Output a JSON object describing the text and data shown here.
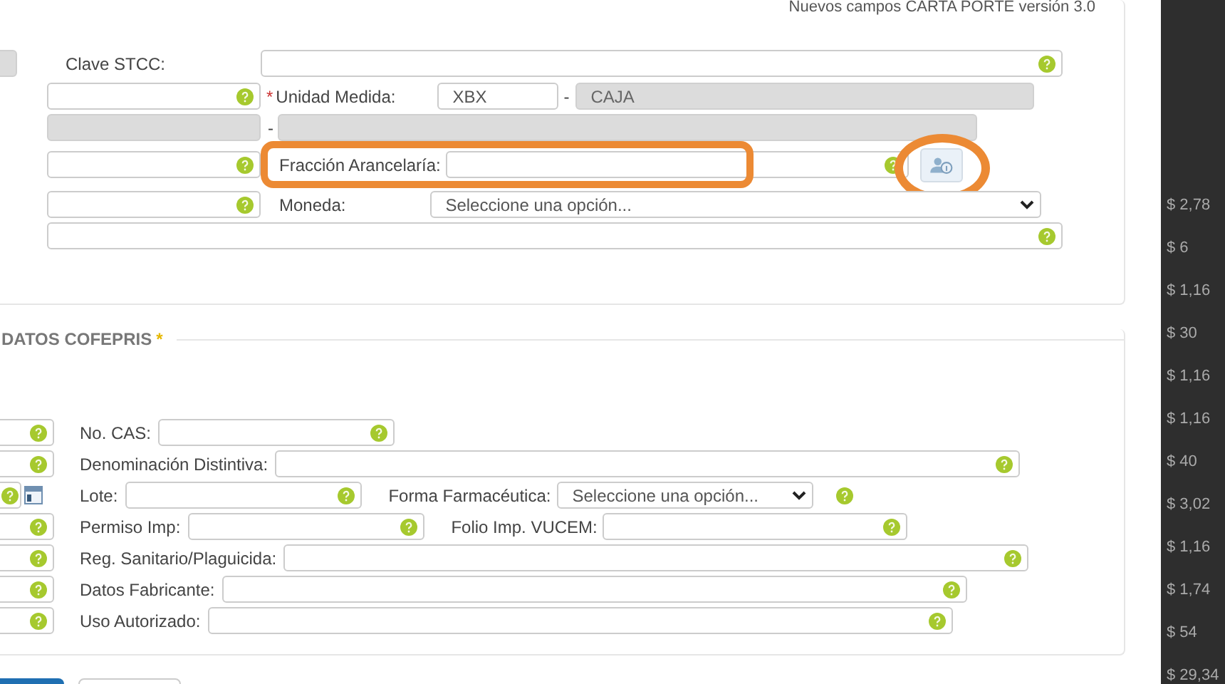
{
  "header_note": "Nuevos campos CARTA PORTE versión 3.0",
  "mercancia": {
    "clave_stcc": {
      "label": "Clave STCC:",
      "left_field": {
        "disabled": true
      }
    },
    "unidad_medida": {
      "required_mark": "*",
      "label": "Unidad Medida:",
      "code": "XBX",
      "separator": "-",
      "description": "CAJA",
      "description_disabled": true
    },
    "linked_row": {
      "separator": "-",
      "disabled": true
    },
    "fraccion_arancelaria": {
      "label": "Fracción Arancelaría:",
      "highlighted": true,
      "lookup_button": {
        "highlighted": true
      }
    },
    "moneda": {
      "label": "Moneda:",
      "value": "Seleccione una opción..."
    }
  },
  "datos_cofepris": {
    "title": "DATOS COFEPRIS",
    "required_mark": "*",
    "left_fields": [
      {
        "kind": "text"
      },
      {
        "kind": "text"
      },
      {
        "kind": "date"
      },
      {
        "kind": "text"
      },
      {
        "kind": "text"
      },
      {
        "kind": "text"
      },
      {
        "kind": "text"
      }
    ],
    "rows": [
      {
        "label": "No. CAS:",
        "kind": "short"
      },
      {
        "label": "Denominación Distintiva:",
        "kind": "wide"
      },
      {
        "label": "Lote:",
        "kind": "short",
        "extra": {
          "kind": "select",
          "label": "Forma Farmacéutica:",
          "value": "Seleccione una opción..."
        }
      },
      {
        "label": "Permiso Imp:",
        "kind": "short",
        "extra": {
          "kind": "text",
          "label": "Folio Imp. VUCEM:"
        }
      },
      {
        "label": "Reg. Sanitario/Plaguicida:",
        "kind": "wide"
      },
      {
        "label": "Datos Fabricante:",
        "kind": "wide"
      },
      {
        "label": "Uso Autorizado:",
        "kind": "wide"
      }
    ]
  },
  "background_amounts": [
    "$ 2,78",
    "$ 6",
    "$ 1,16",
    "$ 30",
    "$ 1,16",
    "$ 1,16",
    "$ 40",
    "$ 3,02",
    "$ 1,16",
    "$ 1,74",
    "$ 54",
    "$ 29,34"
  ]
}
